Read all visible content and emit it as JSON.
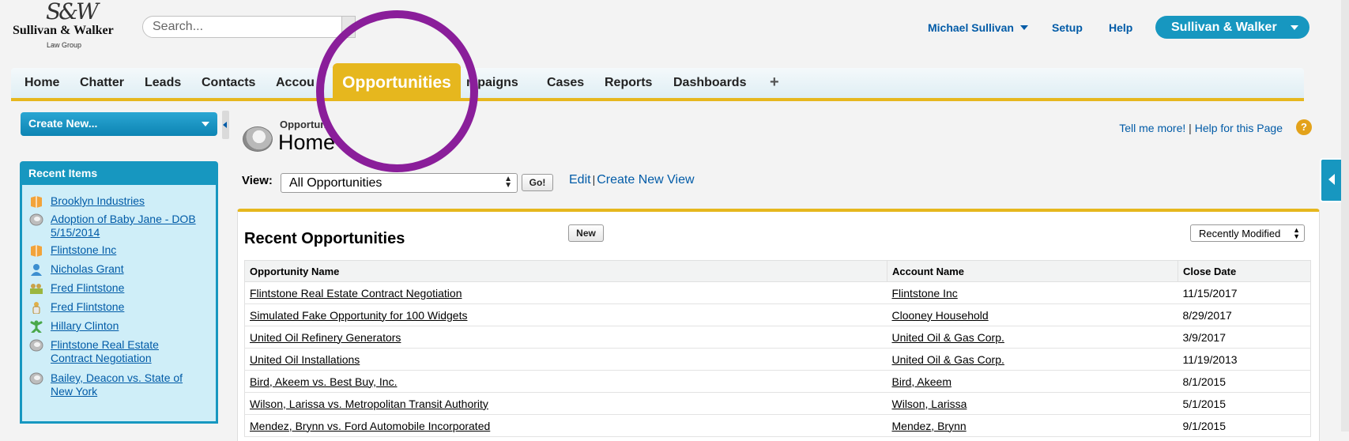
{
  "brand": {
    "monogram": "S&W",
    "name": "Sullivan & Walker",
    "sub": "Law Group"
  },
  "search": {
    "placeholder": "Search..."
  },
  "header": {
    "user": "Michael Sullivan",
    "setup": "Setup",
    "help": "Help",
    "app": "Sullivan & Walker"
  },
  "tabs": {
    "home": "Home",
    "chatter": "Chatter",
    "leads": "Leads",
    "contacts": "Contacts",
    "accounts": "Accou",
    "opportunities": "Opportunities",
    "campaigns": "mpaigns",
    "cases": "Cases",
    "reports": "Reports",
    "dashboards": "Dashboards",
    "plus": "+"
  },
  "sidebar": {
    "create_new": "Create New...",
    "recent_title": "Recent Items",
    "items": [
      {
        "label": "Brooklyn Industries",
        "icon": "account-icon"
      },
      {
        "label": "Adoption of Baby Jane - DOB 5/15/2014",
        "icon": "opportunity-icon"
      },
      {
        "label": "Flintstone Inc",
        "icon": "account-icon"
      },
      {
        "label": "Nicholas Grant",
        "icon": "contact-icon"
      },
      {
        "label": "Fred Flintstone",
        "icon": "household-icon"
      },
      {
        "label": "Fred Flintstone",
        "icon": "person-icon"
      },
      {
        "label": "Hillary Clinton",
        "icon": "lead-icon"
      },
      {
        "label": "Flintstone Real Estate Contract Negotiation",
        "icon": "opportunity-icon"
      },
      {
        "label": "Bailey, Deacon vs. State of New York",
        "icon": "opportunity-icon"
      }
    ]
  },
  "main": {
    "breadcrumb": "Opportuni",
    "title": "Home",
    "tell_me_more": "Tell me more!",
    "help_page": "Help for this Page",
    "help_sep": "|",
    "view_label": "View:",
    "view_value": "All Opportunities",
    "go": "Go!",
    "edit": "Edit",
    "edit_sep": "|",
    "create_view": "Create New View"
  },
  "recent": {
    "title": "Recent Opportunities",
    "new_button": "New",
    "sort": "Recently Modified",
    "columns": [
      "Opportunity Name",
      "Account Name",
      "Close Date"
    ],
    "rows": [
      [
        "Flintstone Real Estate Contract Negotiation",
        "Flintstone Inc",
        "11/15/2017"
      ],
      [
        "Simulated Fake Opportunity for 100 Widgets",
        "Clooney Household",
        "8/29/2017"
      ],
      [
        "United Oil Refinery Generators",
        "United Oil & Gas Corp.",
        "3/9/2017"
      ],
      [
        "United Oil Installations",
        "United Oil & Gas Corp.",
        "11/19/2013"
      ],
      [
        "Bird, Akeem vs. Best Buy, Inc.",
        "Bird, Akeem",
        "8/1/2015"
      ],
      [
        "Wilson, Larissa vs. Metropolitan Transit Authority",
        "Wilson, Larissa",
        "5/1/2015"
      ],
      [
        "Mendez, Brynn vs. Ford Automobile Incorporated",
        "Mendez, Brynn",
        "9/1/2015"
      ]
    ]
  },
  "colors": {
    "accent": "#e6b71e",
    "brand_blue": "#1797c0",
    "link": "#015ba7",
    "highlight": "#8a1e9a"
  }
}
